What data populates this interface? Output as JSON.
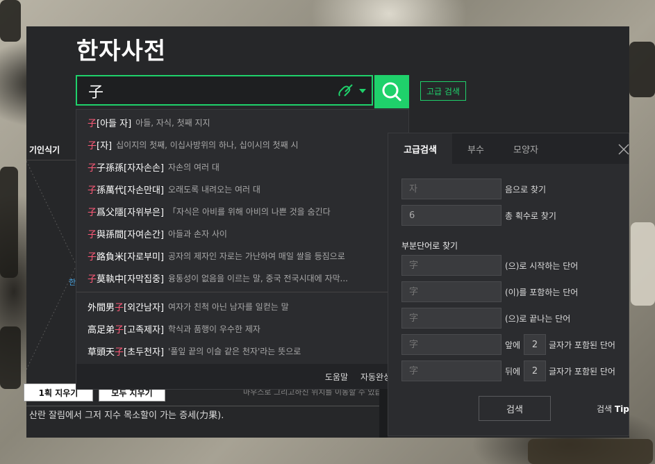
{
  "app": {
    "title": "한자사전",
    "accent_color": "#1fd16b",
    "highlight_color": "#ff5a78"
  },
  "search": {
    "value": "子",
    "handwrite_icon": "link-pen-icon",
    "search_icon": "search-icon",
    "advanced_label": "고급 검색"
  },
  "suggestions": [
    {
      "pre": "",
      "hl": "子",
      "post": "",
      "reading": "[아들 자]",
      "meaning": "아들, 자식, 첫째 지지"
    },
    {
      "pre": "",
      "hl": "子",
      "post": "",
      "reading": "[자]",
      "meaning": "십이지의 첫째, 이십사방위의 하나, 십이시의 첫째 시"
    },
    {
      "pre": "",
      "hl": "子",
      "post": "子孫孫",
      "reading": "[자자손손]",
      "meaning": "자손의 여러 대"
    },
    {
      "pre": "",
      "hl": "子",
      "post": "孫萬代",
      "reading": "[자손만대]",
      "meaning": "오래도록 내려오는 여러 대"
    },
    {
      "pre": "",
      "hl": "子",
      "post": "爲父隱",
      "reading": "[자위부은]",
      "meaning": "「자식은 아비를 위해 아비의 나쁜 것을 숨긴다"
    },
    {
      "pre": "",
      "hl": "子",
      "post": "與孫間",
      "reading": "[자여손간]",
      "meaning": "아들과 손자 사이"
    },
    {
      "pre": "",
      "hl": "子",
      "post": "路負米",
      "reading": "[자로부미]",
      "meaning": "공자의 제자인 자로는 가난하여 매일 쌀을 등짐으로"
    },
    {
      "pre": "",
      "hl": "子",
      "post": "莫執中",
      "reading": "[자막집중]",
      "meaning": "융통성이 없음을 이르는 말, 중국 전국시대에 자막..."
    },
    {
      "pre": "外間男",
      "hl": "子",
      "post": "",
      "reading": "[외간남자]",
      "meaning": "여자가 친척 아닌 남자를 일컫는 말"
    },
    {
      "pre": "高足弟",
      "hl": "子",
      "post": "",
      "reading": "[고족제자]",
      "meaning": "학식과 품행이 우수한 제자"
    },
    {
      "pre": "草頭天",
      "hl": "子",
      "post": "",
      "reading": "[초두천자]",
      "meaning": "'풀잎 끝의 이슬 같은 천자'라는 뜻으로"
    }
  ],
  "suggest_footer": {
    "help": "도움말",
    "autocomplete": "자동완성 끄"
  },
  "background_ui": {
    "left_tab": "기인식기",
    "hint_char": "한",
    "erase_one": "1획 지우기",
    "erase_all": "모두 지우기",
    "bottom_text": "산란 잘림에서 그저 지수 목소할이 가는 증세(力果).",
    "behind_hint": "마우스로 그리고하신 위치를 이동할 수 있습니다."
  },
  "advanced": {
    "tabs": [
      "고급검색",
      "부수",
      "모양자"
    ],
    "active_tab": 0,
    "close_icon": "close-icon",
    "reading": {
      "placeholder": "자",
      "label": "음으로 찾기"
    },
    "strokes": {
      "value": "6",
      "label": "총 획수로 찾기"
    },
    "section_title": "부분단어로 찾기",
    "partials": [
      {
        "placeholder": "字",
        "label": "(으)로 시작하는 단어"
      },
      {
        "placeholder": "字",
        "label": "(이)를 포함하는 단어"
      },
      {
        "placeholder": "字",
        "label": "(으)로 끝나는 단어"
      }
    ],
    "front": {
      "placeholder": "字",
      "pre": "앞에",
      "count": "2",
      "post": "글자가 포함된 단어"
    },
    "back": {
      "placeholder": "字",
      "pre": "뒤에",
      "count": "2",
      "post": "글자가 포함된 단어"
    },
    "submit": "검색",
    "tip_prefix": "검색",
    "tip_bold": "Tip"
  }
}
